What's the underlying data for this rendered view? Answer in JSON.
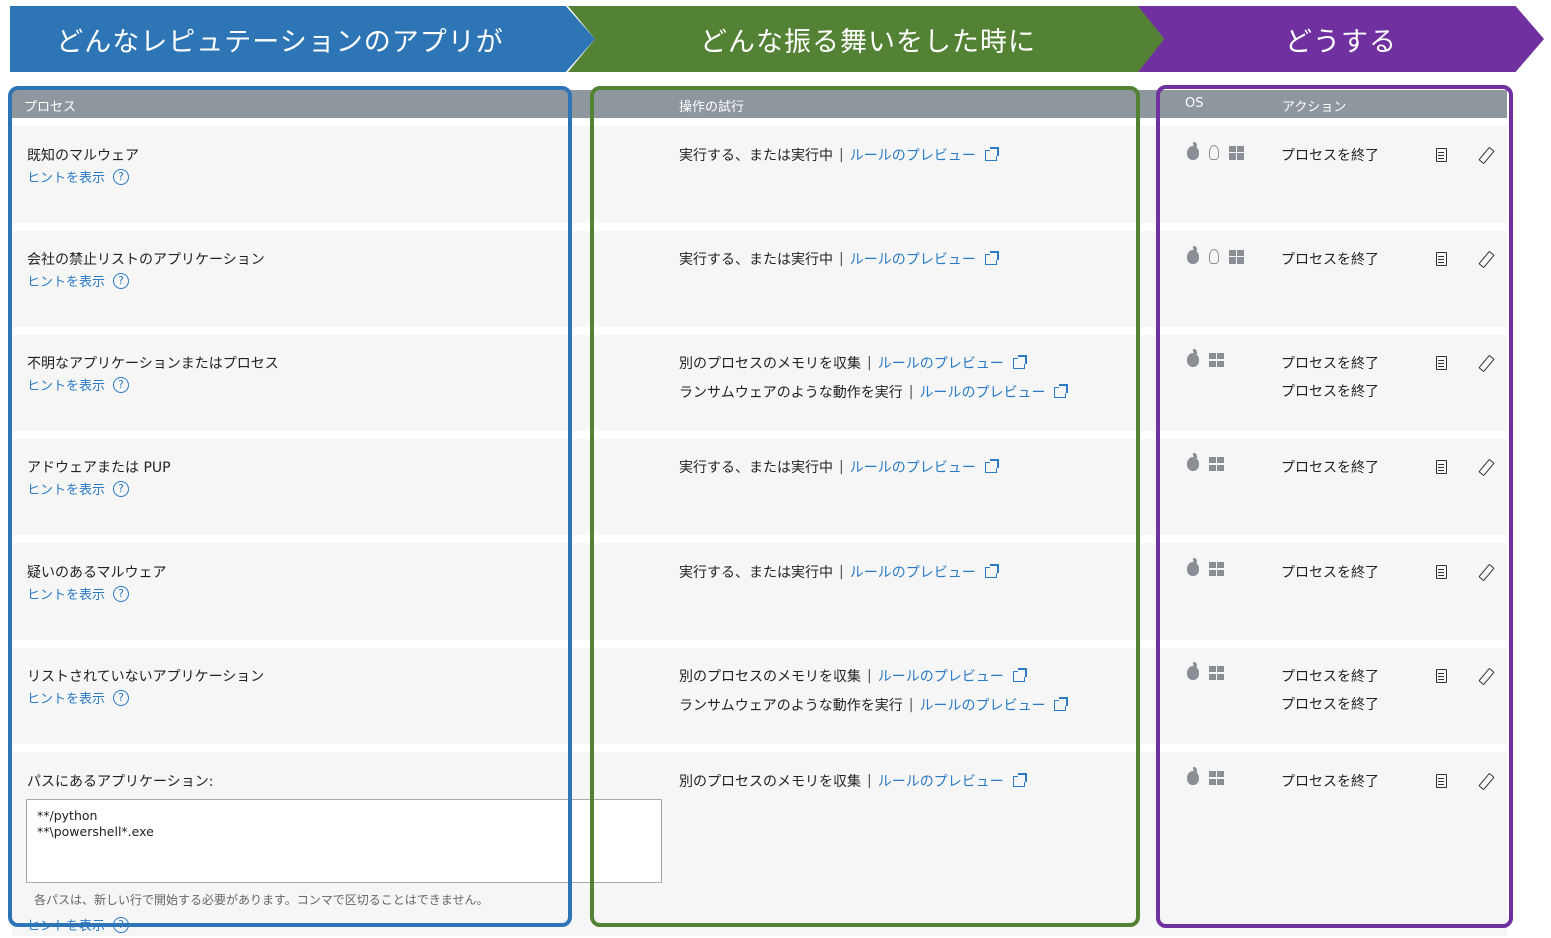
{
  "banners": {
    "who": "どんなレピュテーションのアプリが",
    "when": "どんな振る舞いをした時に",
    "what": "どうする"
  },
  "headers": {
    "process": "プロセス",
    "operation": "操作の試行",
    "os": "OS",
    "action": "アクション"
  },
  "common": {
    "hint_label": "ヒントを表示",
    "qmark": "?",
    "preview_link": "ルールのプレビュー",
    "separator": "|",
    "terminate": "プロセスを終了"
  },
  "rows": [
    {
      "name": "既知のマルウェア",
      "ops": [
        "実行する、または実行中"
      ],
      "os": [
        "apple",
        "linux",
        "windows"
      ]
    },
    {
      "name": "会社の禁止リストのアプリケーション",
      "ops": [
        "実行する、または実行中"
      ],
      "os": [
        "apple",
        "linux",
        "windows"
      ]
    },
    {
      "name": "不明なアプリケーションまたはプロセス",
      "ops": [
        "別のプロセスのメモリを収集",
        "ランサムウェアのような動作を実行"
      ],
      "os": [
        "apple",
        "windows"
      ]
    },
    {
      "name": "アドウェアまたは PUP",
      "ops": [
        "実行する、または実行中"
      ],
      "os": [
        "apple",
        "windows"
      ]
    },
    {
      "name": "疑いのあるマルウェア",
      "ops": [
        "実行する、または実行中"
      ],
      "os": [
        "apple",
        "windows"
      ]
    },
    {
      "name": "リストされていないアプリケーション",
      "ops": [
        "別のプロセスのメモリを収集",
        "ランサムウェアのような動作を実行"
      ],
      "os": [
        "apple",
        "windows"
      ]
    },
    {
      "name": "パスにあるアプリケーション:",
      "ops": [
        "別のプロセスのメモリを収集"
      ],
      "os": [
        "apple",
        "windows"
      ]
    }
  ],
  "path_rule": {
    "lines": [
      "**/python",
      "**\\powershell*.exe"
    ],
    "help": "各パスは、新しい行で開始する必要があります。コンマで区切ることはできません。"
  },
  "colors": {
    "blue": "#2e75b6",
    "green": "#548235",
    "purple": "#7030a0",
    "link": "#2a7ac4",
    "header_bg": "#8e969e"
  }
}
